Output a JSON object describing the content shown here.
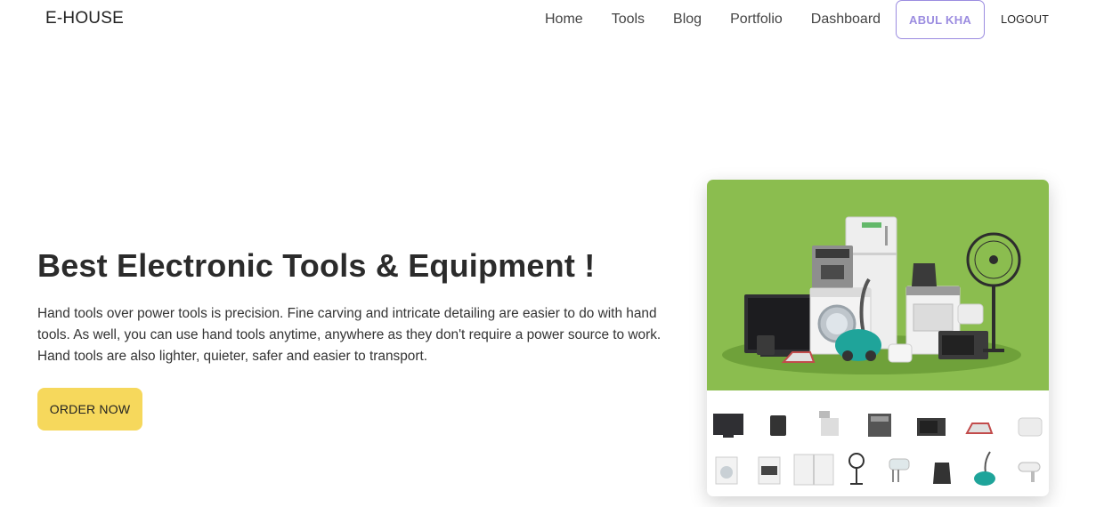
{
  "navbar": {
    "brand": "E-HOUSE",
    "links": [
      "Home",
      "Tools",
      "Blog",
      "Portfolio",
      "Dashboard"
    ],
    "user_label": "ABUL KHA",
    "logout_label": "LOGOUT"
  },
  "hero": {
    "title": "Best Electronic Tools & Equipment !",
    "description": "Hand tools over power tools is precision. Fine carving and intricate detailing are easier to do with hand tools. As well, you can use hand tools anytime, anywhere as they don't require a power source to work. Hand tools are also lighter, quieter, safer and easier to transport.",
    "cta_label": "ORDER NOW"
  },
  "illustration": {
    "background_color": "#8bbd4f",
    "accent_colors": [
      "#f6d85c",
      "#9b8ce0",
      "#1fa49a"
    ],
    "icon_row_1": [
      "tv-icon",
      "phone-icon",
      "meat-grinder-icon",
      "coffee-machine-icon",
      "microwave-icon",
      "iron-icon",
      "toaster-icon"
    ],
    "icon_row_2": [
      "washing-machine-icon",
      "stove-icon",
      "fridge-icon",
      "fan-icon",
      "mixer-icon",
      "kettle-icon",
      "vacuum-icon",
      "hair-dryer-icon"
    ]
  }
}
